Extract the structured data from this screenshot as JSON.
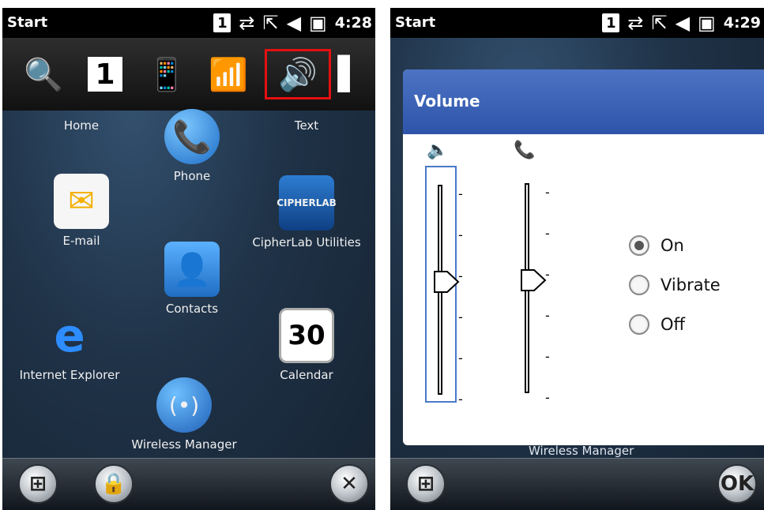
{
  "left": {
    "status": {
      "title": "Start",
      "time": "4:28",
      "box": "1"
    },
    "tray_icons": [
      "magnifier-icon",
      "one-icon",
      "sync-icon",
      "signal-phone-icon",
      "speaker-icon",
      "battery-icon"
    ],
    "apps": [
      {
        "label": "Home",
        "icon": "home-icon"
      },
      {
        "label": "Phone",
        "icon": "phone-icon"
      },
      {
        "label": "Text",
        "icon": "text-icon"
      },
      {
        "label": "E-mail",
        "icon": "mail-icon"
      },
      {
        "label": "CipherLab Utilities",
        "icon": "cipherlab-icon"
      },
      {
        "label": "Contacts",
        "icon": "contacts-icon"
      },
      {
        "label": "Internet Explorer",
        "icon": "ie-icon"
      },
      {
        "label": "Calendar",
        "icon": "calendar-icon",
        "value": "30"
      },
      {
        "label": "Wireless Manager",
        "icon": "wireless-icon"
      }
    ]
  },
  "right": {
    "status": {
      "title": "Start",
      "time": "4:29",
      "box": "1"
    },
    "dialog": {
      "title": "Volume",
      "options": [
        {
          "label": "On",
          "checked": true
        },
        {
          "label": "Vibrate",
          "checked": false
        },
        {
          "label": "Off",
          "checked": false
        }
      ],
      "bottom_label": "Wireless Manager",
      "ok_label": "OK",
      "sliders": [
        {
          "name": "device-volume",
          "level": 0.5
        },
        {
          "name": "phone-volume",
          "level": 0.5
        }
      ]
    }
  },
  "colors": {
    "highlight": "#e41010",
    "header": "#3b62b8"
  }
}
